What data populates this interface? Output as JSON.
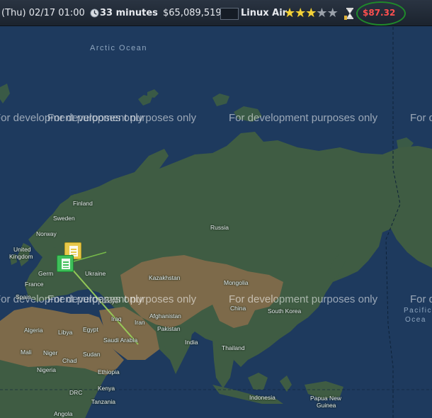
{
  "topbar": {
    "datetime": "(Thu) 02/17 01:00",
    "duration": "33 minutes",
    "cash": "$65,089,519",
    "airline": "Linux Air",
    "rating": {
      "filled": 3,
      "total": 5
    },
    "price": "$87.32",
    "icons": [
      "clock-icon",
      "hourglass-icon"
    ]
  },
  "map": {
    "watermark": "For development purposes only",
    "oceans": {
      "arctic": "Arctic Ocean",
      "pacific_1": "Pacific",
      "pacific_2": "Ocea"
    },
    "labels": {
      "finland": "Finland",
      "sweden": "Sweden",
      "norway": "Norway",
      "uk_1": "United",
      "uk_2": "Kingdom",
      "germany": "Germ",
      "france": "France",
      "spain": "Spain",
      "ukraine": "Ukraine",
      "russia": "Russia",
      "kazakhstan": "Kazakhstan",
      "mongolia": "Mongolia",
      "china": "China",
      "south_korea": "South Korea",
      "turkiye": "Türkiye",
      "iraq": "Iraq",
      "iran": "Iran",
      "afghanistan": "Afghanistan",
      "pakistan": "Pakistan",
      "india": "India",
      "thailand": "Thailand",
      "saudi": "Saudi Arabia",
      "algeria": "Algeria",
      "libya": "Libya",
      "egypt": "Egypt",
      "mali": "Mali",
      "niger": "Niger",
      "chad": "Chad",
      "sudan": "Sudan",
      "nigeria": "Nigeria",
      "ethiopia": "Ethiopia",
      "drc": "DRC",
      "kenya": "Kenya",
      "tanzania": "Tanzania",
      "angola": "Angola",
      "indonesia": "Indonesia",
      "png_1": "Papua New",
      "png_2": "Guinea"
    }
  },
  "colors": {
    "ocean": "#1e3a5e",
    "land_green": "#3f5c43",
    "land_desert": "#7d6a4a",
    "price": "#ff4f4f",
    "route": "#7cc34a"
  }
}
